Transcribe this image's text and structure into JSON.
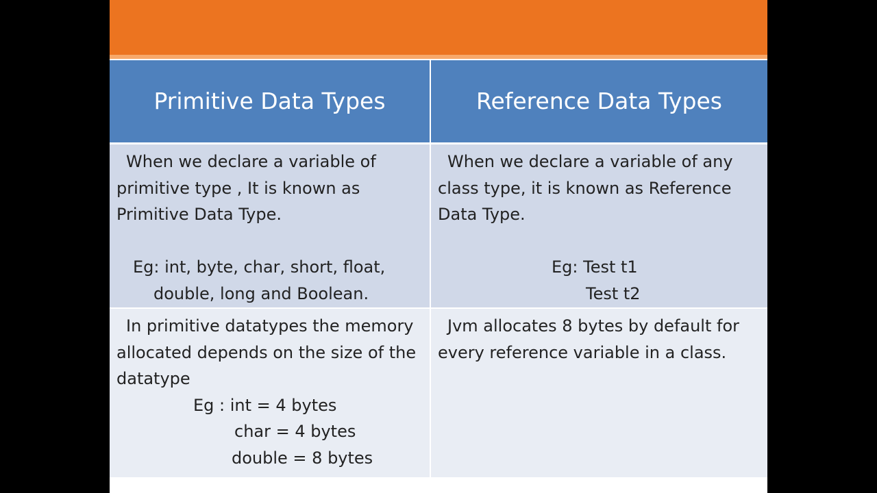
{
  "header": {
    "col1": "Primitive Data Types",
    "col2": "Reference  Data Types"
  },
  "rows": [
    {
      "primitive": {
        "description": "When we declare a variable of primitive type , It is known as Primitive Data Type.",
        "example_line1": "Eg:   int, byte, char, short, float,",
        "example_line2": "double, long and Boolean."
      },
      "reference": {
        "description": "When we declare a variable of any class type, it is known as Reference Data Type.",
        "example_line1": "Eg:  Test t1",
        "example_line2": "Test t2"
      }
    },
    {
      "primitive": {
        "description": "In primitive datatypes the memory allocated depends on the size of the datatype",
        "example_line1": "Eg :  int =  4 bytes",
        "example_line2": "char = 4 bytes",
        "example_line3": "double = 8 bytes"
      },
      "reference": {
        "description": "Jvm allocates 8 bytes by default for every reference variable in a class."
      }
    }
  ],
  "colors": {
    "orange_bar": "#ec7420",
    "header_blue": "#4f81bd",
    "row1_bg": "#d0d8e8",
    "row2_bg": "#e9edf4"
  }
}
